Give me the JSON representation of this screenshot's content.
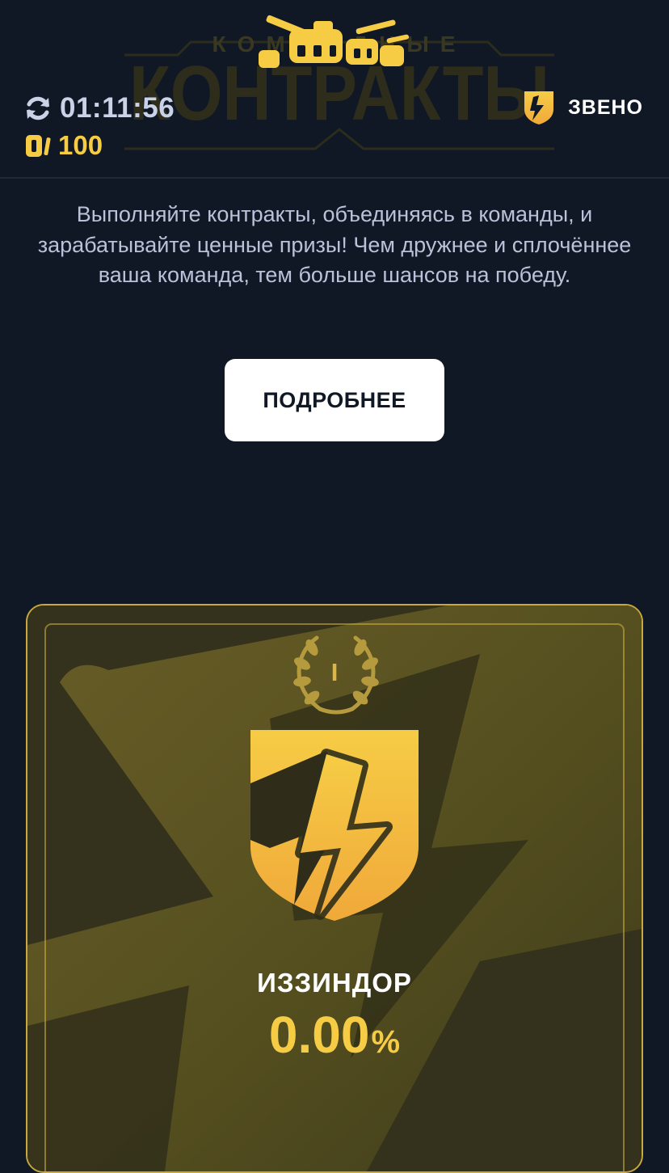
{
  "header": {
    "logo": {
      "line1": "КОМАНДНЫЕ",
      "line2": "КОНТРАКТЫ",
      "icon": "tanks-icon"
    },
    "timer": {
      "icon": "refresh-icon",
      "value": "01:11:56"
    },
    "coins": {
      "icon": "coin-icon",
      "value": "100"
    },
    "unit": {
      "icon": "unit-shield-icon",
      "label": "ЗВЕНО"
    }
  },
  "intro": {
    "description": "Выполняйте контракты, объединяясь в команды, и зарабатывайте ценные призы! Чем дружнее и сплочённее ваша команда, тем больше шансов на победу.",
    "details_button": "ПОДРОБНЕЕ"
  },
  "team_card": {
    "rank": "I",
    "rank_icon": "laurel-wreath-icon",
    "emblem_icon": "lightning-shield-icon",
    "name": "ИЗЗИНДОР",
    "percent_value": "0.00",
    "percent_sign": "%"
  },
  "colors": {
    "background": "#0f1824",
    "accent_yellow": "#f6cc45",
    "card_border": "#c9a93e",
    "text_muted": "#b9c2d8"
  }
}
